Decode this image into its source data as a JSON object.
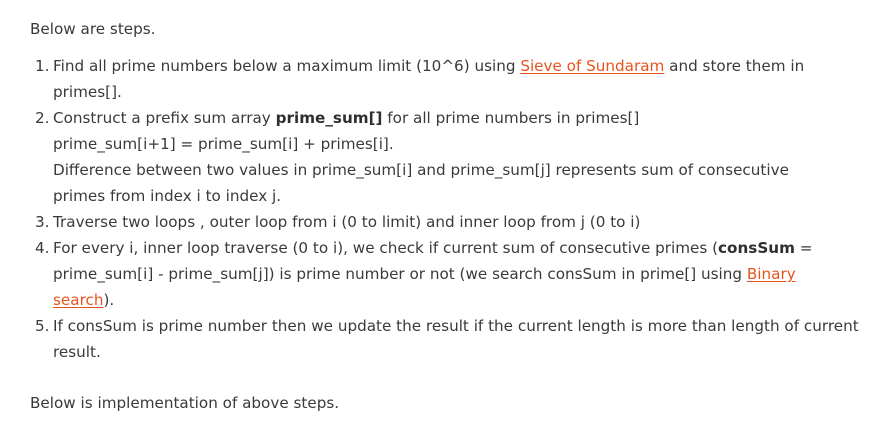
{
  "intro": "Below are steps.",
  "steps": [
    {
      "num": "1.",
      "t1": "Find all prime numbers below a maximum limit (10^6) using ",
      "link": "Sieve of Sundaram",
      "t2": " and store them in",
      "line2": "primes[]."
    },
    {
      "num": "2.",
      "t1": "Construct a prefix sum array ",
      "bold": "prime_sum[]",
      "t2": " for all prime numbers in primes[]",
      "line2": "prime_sum[i+1] = prime_sum[i] + primes[i].",
      "line3": "Difference between two values in prime_sum[i] and prime_sum[j] represents sum of consecutive",
      "line4": "primes from index i to index j."
    },
    {
      "num": "3.",
      "text": "Traverse two loops , outer loop from i (0 to limit) and inner loop from j (0 to i)"
    },
    {
      "num": "4.",
      "t1": "For every i, inner loop traverse (0 to i), we check if current sum of consecutive primes (",
      "bold": "consSum",
      "t2": " =",
      "line2a": "prime_sum[i] - prime_sum[j]) is prime number or not (we search consSum in prime[] using ",
      "link_a": "Binary",
      "link_b": "search",
      "t3": ")."
    },
    {
      "num": "5.",
      "line1": "If consSum is prime number then we update the result if the current length is more than length of current",
      "line2": "result."
    }
  ],
  "outro": "Below is implementation of above steps.",
  "colors": {
    "text": "#3a3a3a",
    "link": "#e8531b"
  }
}
